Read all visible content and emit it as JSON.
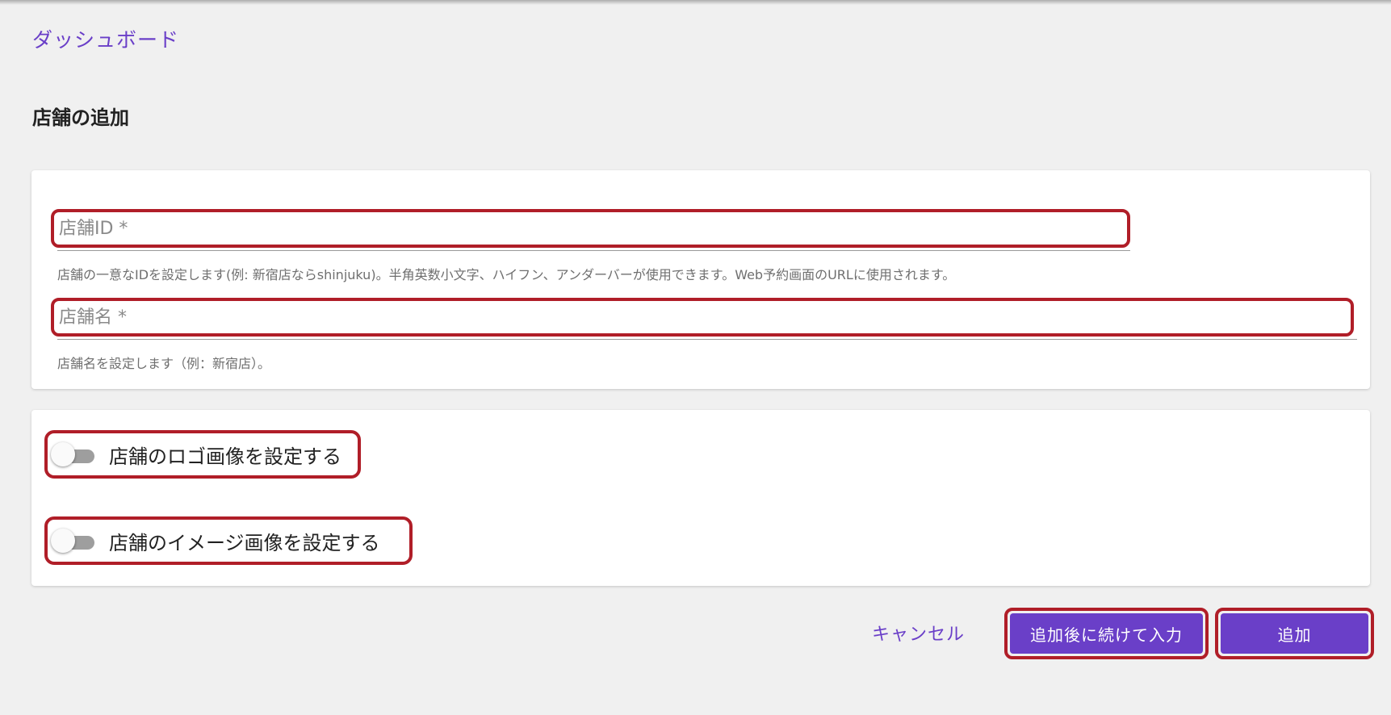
{
  "header": {
    "breadcrumb": "ダッシュボード",
    "page_title": "店舗の追加"
  },
  "form": {
    "store_id": {
      "value": "",
      "placeholder": "店舗ID *",
      "helper": "店舗の一意なIDを設定します(例: 新宿店ならshinjuku)。半角英数小文字、ハイフン、アンダーバーが使用できます。Web予約画面のURLに使用されます。"
    },
    "store_name": {
      "value": "",
      "placeholder": "店舗名 *",
      "helper": "店舗名を設定します（例：新宿店）。"
    }
  },
  "toggles": {
    "logo": {
      "label": "店舗のロゴ画像を設定する",
      "checked": false
    },
    "image": {
      "label": "店舗のイメージ画像を設定する",
      "checked": false
    }
  },
  "actions": {
    "cancel_label": "キャンセル",
    "add_continue_label": "追加後に続けて入力",
    "add_label": "追加"
  },
  "colors": {
    "accent": "#6a3fc8",
    "highlight": "#b01e28",
    "background": "#f0f0f0"
  }
}
